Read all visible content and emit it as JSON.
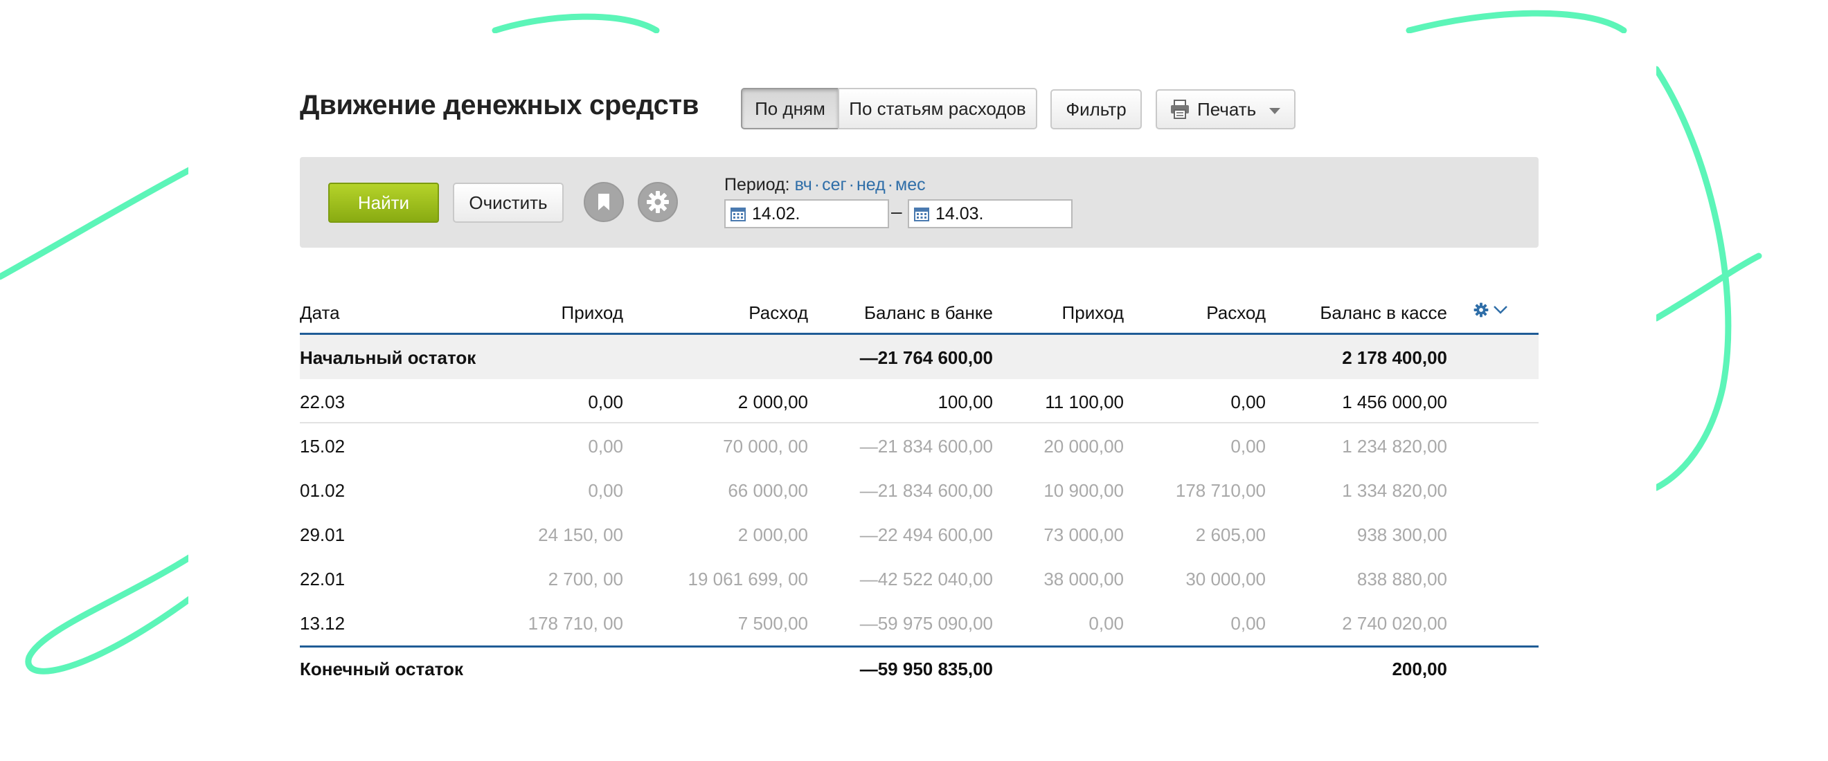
{
  "title": "Движение денежных средств",
  "view_toggle": {
    "by_days": "По дням",
    "by_categories": "По статьям расходов"
  },
  "filter_label": "Фильтр",
  "print_label": "Печать",
  "search": {
    "find_label": "Найти",
    "clear_label": "Очистить"
  },
  "period": {
    "label": "Период:",
    "shortcuts": [
      "вч",
      "сег",
      "нед",
      "мес"
    ],
    "from": "14.02.",
    "separator": "–",
    "to": "14.03."
  },
  "columns": [
    "Дата",
    "Приход",
    "Расход",
    "Баланс в банке",
    "Приход",
    "Расход",
    "Баланс в кассе"
  ],
  "opening": {
    "label": "Начальный остаток",
    "bank_balance": "—21 764 600,00",
    "cash_balance": "2 178 400,00"
  },
  "rows": [
    {
      "date": "22.03",
      "bank_in": "0,00",
      "bank_out": "2 000,00",
      "bank_balance": "100,00",
      "cash_in": "11 100,00",
      "cash_out": "0,00",
      "cash_balance": "1 456 000,00"
    },
    {
      "date": "15.02",
      "bank_in": "0,00",
      "bank_out": "70 000, 00",
      "bank_balance": "—21 834 600,00",
      "cash_in": "20 000,00",
      "cash_out": "0,00",
      "cash_balance": "1 234 820,00"
    },
    {
      "date": "01.02",
      "bank_in": "0,00",
      "bank_out": "66 000,00",
      "bank_balance": "—21 834 600,00",
      "cash_in": "10 900,00",
      "cash_out": "178 710,00",
      "cash_balance": "1 334 820,00"
    },
    {
      "date": "29.01",
      "bank_in": "24 150, 00",
      "bank_out": "2 000,00",
      "bank_balance": "—22 494 600,00",
      "cash_in": "73 000,00",
      "cash_out": "2 605,00",
      "cash_balance": "938 300,00"
    },
    {
      "date": "22.01",
      "bank_in": "2 700, 00",
      "bank_out": "19 061 699, 00",
      "bank_balance": "—42 522 040,00",
      "cash_in": "38 000,00",
      "cash_out": "30 000,00",
      "cash_balance": "838 880,00"
    },
    {
      "date": "13.12",
      "bank_in": "178 710, 00",
      "bank_out": "7 500,00",
      "bank_balance": "—59 975 090,00",
      "cash_in": "0,00",
      "cash_out": "0,00",
      "cash_balance": "2 740 020,00"
    }
  ],
  "closing": {
    "label": "Конечный остаток",
    "bank_balance": "—59 950 835,00",
    "cash_balance": "200,00"
  },
  "colors": {
    "accent_stroke": "#5cf5b8",
    "link": "#2f6ea8",
    "find_button": "#9cbd1d",
    "table_rule": "#1f5c96",
    "muted_text": "#a9a9a9"
  },
  "icons": {
    "print": "printer-icon",
    "bookmark": "bookmark-icon",
    "settings": "gear-icon",
    "calendar": "calendar-icon",
    "column_settings": "gear-icon",
    "expand": "chevron-down-icon"
  }
}
